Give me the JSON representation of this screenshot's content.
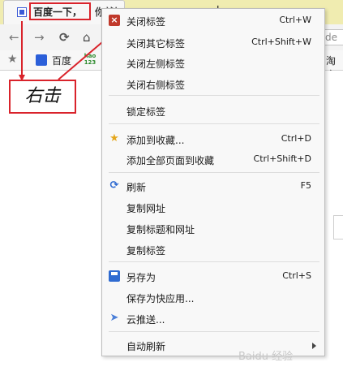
{
  "tab": {
    "title": "百度一下，",
    "title_suffix": "你就知道"
  },
  "toolbar": {
    "back": "←",
    "forward": "→",
    "reload": "⟳",
    "home": "⌂",
    "url_text": "de"
  },
  "bookmarks": {
    "star": "★",
    "baidu": "百度",
    "hao_line1": "hao",
    "hao_line2": "123",
    "right_item": "淘宝"
  },
  "newtab": "+",
  "annotation": {
    "text": "右击",
    "color": "#d9232b"
  },
  "menu": {
    "items": [
      {
        "label": "关闭标签",
        "shortcut": "Ctrl+W"
      },
      {
        "label": "关闭其它标签",
        "shortcut": "Ctrl+Shift+W"
      },
      {
        "label": "关闭左侧标签",
        "shortcut": ""
      },
      {
        "label": "关闭右侧标签",
        "shortcut": ""
      },
      {
        "label": "锁定标签",
        "shortcut": ""
      },
      {
        "label": "添加到收藏...",
        "shortcut": "Ctrl+D"
      },
      {
        "label": "添加全部页面到收藏",
        "shortcut": "Ctrl+Shift+D"
      },
      {
        "label": "刷新",
        "shortcut": "F5"
      },
      {
        "label": "复制网址",
        "shortcut": ""
      },
      {
        "label": "复制标题和网址",
        "shortcut": ""
      },
      {
        "label": "复制标签",
        "shortcut": ""
      },
      {
        "label": "另存为",
        "shortcut": "Ctrl+S"
      },
      {
        "label": "保存为快应用...",
        "shortcut": ""
      },
      {
        "label": "云推送...",
        "shortcut": ""
      },
      {
        "label": "自动刷新",
        "shortcut": ""
      }
    ],
    "icons": {
      "close": "×",
      "favorite": "★",
      "refresh": "⟳",
      "send": "➤"
    }
  },
  "watermark": "Baidu 经验"
}
